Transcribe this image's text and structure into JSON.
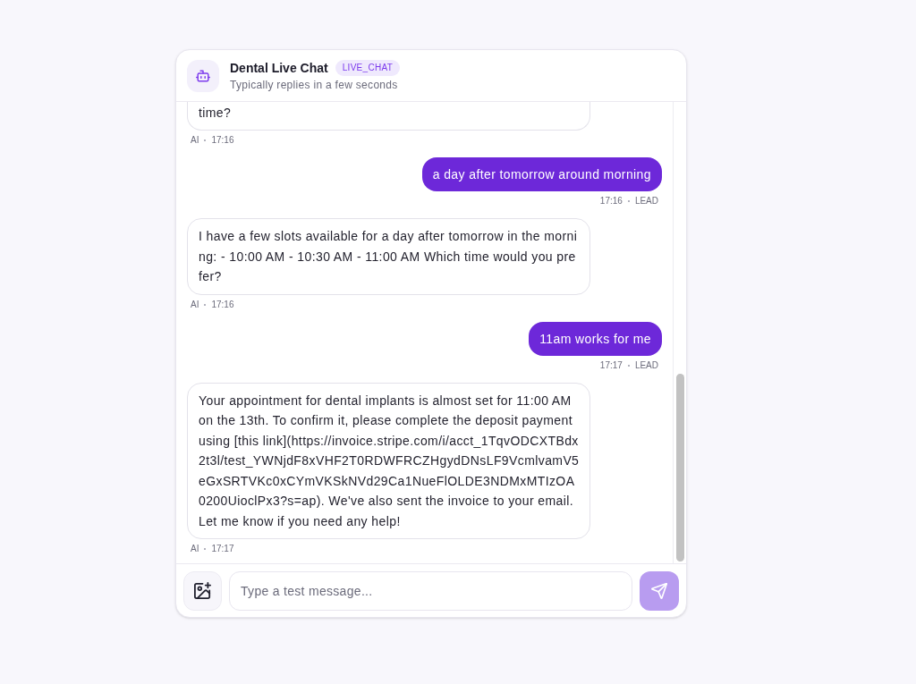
{
  "header": {
    "title": "Dental Live Chat",
    "badge": "LIVE_CHAT",
    "subtitle": "Typically replies in a few seconds"
  },
  "messages": [
    {
      "kind": "ai",
      "text": "time?",
      "author": "AI",
      "time": "17:16",
      "cut_off": true
    },
    {
      "kind": "lead",
      "text": "a day after tomorrow around morning",
      "author": "LEAD",
      "time": "17:16",
      "cut_off": false
    },
    {
      "kind": "ai",
      "text": "I have a few slots available for a day after tomorrow in the morning: - 10:00 AM - 10:30 AM - 11:00 AM Which time would you prefer?",
      "author": "AI",
      "time": "17:16",
      "cut_off": false
    },
    {
      "kind": "lead",
      "text": "11am works for me",
      "author": "LEAD",
      "time": "17:17",
      "cut_off": false
    },
    {
      "kind": "ai",
      "text": "Your appointment for dental implants is almost set for 11:00 AM on the 13th. To confirm it, please complete the deposit payment using [this link](https://invoice.stripe.com/i/acct_1TqvODCXTBdx2t3l/test_YWNjdF8xVHF2T0RDWFRCZHgydDNsLF9VcmlvamV5eGxSRTVKc0xCYmVKSkNVd29Ca1NueFlOLDE3NDMxMTIzOA0200UioclPx3?s=ap). We've also sent the invoice to your email. Let me know if you need any help!",
      "author": "AI",
      "time": "17:17",
      "cut_off": false
    }
  ],
  "composer": {
    "placeholder": "Type a test message...",
    "send_disabled": true
  }
}
